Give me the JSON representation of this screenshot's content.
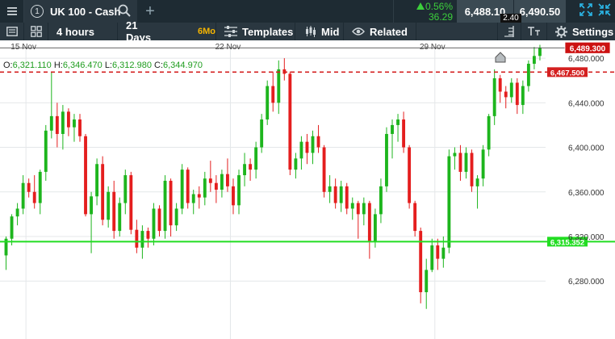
{
  "header": {
    "tab_number": "1",
    "instrument": "UK 100 - Cash",
    "change_pct": "0.56%",
    "change_pts": "36.29",
    "sell_price": "6,488.10",
    "buy_price": "6,490.50",
    "spread": "2.40",
    "icons": [
      "menu-icon",
      "search-icon",
      "plus-icon",
      "triangle-up-icon",
      "expand-icon",
      "collapse-icon"
    ]
  },
  "toolbar": {
    "interval": "4 hours",
    "range": "21 Days",
    "range_badge": "6Mo",
    "templates": "Templates",
    "price_type": "Mid",
    "related": "Related",
    "settings": "Settings",
    "icons": [
      "panel-icon",
      "grid-icon",
      "sliders-icon",
      "candles-icon",
      "eye-icon",
      "ruler-icon",
      "text-icon",
      "gear-icon"
    ]
  },
  "colors": {
    "up": "#1db51d",
    "down": "#e41e1e",
    "current_price": "#cc1111",
    "level": "#22dd22",
    "topbar": "#1e2b33",
    "toolbar": "#2a3740"
  },
  "ohlc": {
    "o_label": "O:",
    "o": "6,321.110",
    "h_label": "H:",
    "h": "6,346.470",
    "l_label": "L:",
    "l": "6,312.980",
    "c_label": "C:",
    "c": "6,344.970"
  },
  "chart_data": {
    "type": "candlestick",
    "x_labels": [
      {
        "label": "15 Nov",
        "index": 4
      },
      {
        "label": "22 Nov",
        "index": 40
      },
      {
        "label": "29 Nov",
        "index": 76
      }
    ],
    "y_ticks": [
      6280,
      6320,
      6360,
      6400,
      6440,
      6480
    ],
    "y_tick_labels": [
      "6,280.000",
      "6,320.000",
      "6,360.000",
      "6,400.000",
      "6,440.000",
      "6,480.000"
    ],
    "ylim": [
      6228,
      6496
    ],
    "current_price": {
      "value": 6489.3,
      "label": "6,489.300"
    },
    "dashed_level": {
      "value": 6467.5,
      "label": "6,467.500"
    },
    "support_level": {
      "value": 6315.352,
      "label": "6,315.352"
    },
    "candles": [
      [
        6303,
        6320,
        6290,
        6318
      ],
      [
        6318,
        6340,
        6312,
        6338
      ],
      [
        6338,
        6350,
        6330,
        6345
      ],
      [
        6345,
        6375,
        6340,
        6368
      ],
      [
        6368,
        6372,
        6355,
        6360
      ],
      [
        6360,
        6375,
        6345,
        6350
      ],
      [
        6350,
        6380,
        6340,
        6378
      ],
      [
        6378,
        6420,
        6370,
        6415
      ],
      [
        6415,
        6468,
        6408,
        6428
      ],
      [
        6428,
        6440,
        6400,
        6412
      ],
      [
        6412,
        6438,
        6398,
        6432
      ],
      [
        6432,
        6435,
        6410,
        6418
      ],
      [
        6418,
        6430,
        6405,
        6425
      ],
      [
        6425,
        6430,
        6405,
        6410
      ],
      [
        6410,
        6412,
        6338,
        6340
      ],
      [
        6340,
        6360,
        6305,
        6356
      ],
      [
        6356,
        6390,
        6348,
        6385
      ],
      [
        6385,
        6392,
        6330,
        6335
      ],
      [
        6335,
        6365,
        6328,
        6360
      ],
      [
        6360,
        6370,
        6318,
        6325
      ],
      [
        6325,
        6355,
        6320,
        6350
      ],
      [
        6350,
        6380,
        6340,
        6375
      ],
      [
        6375,
        6378,
        6322,
        6326
      ],
      [
        6326,
        6335,
        6305,
        6310
      ],
      [
        6310,
        6330,
        6300,
        6325
      ],
      [
        6325,
        6328,
        6310,
        6318
      ],
      [
        6318,
        6350,
        6312,
        6345
      ],
      [
        6345,
        6348,
        6320,
        6325
      ],
      [
        6325,
        6375,
        6318,
        6370
      ],
      [
        6370,
        6372,
        6320,
        6330
      ],
      [
        6330,
        6350,
        6325,
        6345
      ],
      [
        6345,
        6385,
        6340,
        6380
      ],
      [
        6380,
        6382,
        6345,
        6350
      ],
      [
        6350,
        6362,
        6340,
        6358
      ],
      [
        6358,
        6365,
        6345,
        6355
      ],
      [
        6355,
        6378,
        6348,
        6372
      ],
      [
        6372,
        6388,
        6360,
        6368
      ],
      [
        6368,
        6375,
        6350,
        6362
      ],
      [
        6362,
        6380,
        6355,
        6376
      ],
      [
        6376,
        6390,
        6360,
        6365
      ],
      [
        6365,
        6372,
        6340,
        6348
      ],
      [
        6348,
        6380,
        6340,
        6375
      ],
      [
        6375,
        6395,
        6365,
        6385
      ],
      [
        6385,
        6390,
        6370,
        6380
      ],
      [
        6380,
        6405,
        6372,
        6400
      ],
      [
        6400,
        6430,
        6395,
        6425
      ],
      [
        6425,
        6460,
        6420,
        6455
      ],
      [
        6455,
        6468,
        6432,
        6440
      ],
      [
        6440,
        6478,
        6430,
        6470
      ],
      [
        6470,
        6480,
        6460,
        6466
      ],
      [
        6466,
        6468,
        6375,
        6380
      ],
      [
        6380,
        6395,
        6372,
        6390
      ],
      [
        6390,
        6410,
        6380,
        6405
      ],
      [
        6405,
        6412,
        6385,
        6395
      ],
      [
        6395,
        6415,
        6385,
        6410
      ],
      [
        6410,
        6420,
        6395,
        6400
      ],
      [
        6400,
        6402,
        6355,
        6360
      ],
      [
        6360,
        6375,
        6350,
        6365
      ],
      [
        6365,
        6372,
        6345,
        6350
      ],
      [
        6350,
        6370,
        6342,
        6365
      ],
      [
        6365,
        6368,
        6340,
        6345
      ],
      [
        6345,
        6355,
        6335,
        6350
      ],
      [
        6350,
        6352,
        6318,
        6340
      ],
      [
        6340,
        6355,
        6330,
        6350
      ],
      [
        6350,
        6352,
        6300,
        6315
      ],
      [
        6315,
        6345,
        6310,
        6340
      ],
      [
        6340,
        6372,
        6332,
        6365
      ],
      [
        6365,
        6418,
        6360,
        6412
      ],
      [
        6412,
        6425,
        6390,
        6420
      ],
      [
        6420,
        6430,
        6405,
        6425
      ],
      [
        6425,
        6432,
        6395,
        6400
      ],
      [
        6400,
        6402,
        6345,
        6350
      ],
      [
        6350,
        6352,
        6320,
        6325
      ],
      [
        6325,
        6328,
        6260,
        6270
      ],
      [
        6270,
        6300,
        6255,
        6290
      ],
      [
        6290,
        6318,
        6288,
        6312
      ],
      [
        6312,
        6318,
        6290,
        6300
      ],
      [
        6300,
        6320,
        6292,
        6310
      ],
      [
        6310,
        6398,
        6305,
        6392
      ],
      [
        6392,
        6400,
        6380,
        6395
      ],
      [
        6395,
        6402,
        6370,
        6378
      ],
      [
        6378,
        6400,
        6372,
        6395
      ],
      [
        6395,
        6398,
        6360,
        6365
      ],
      [
        6365,
        6375,
        6345,
        6372
      ],
      [
        6372,
        6402,
        6365,
        6398
      ],
      [
        6398,
        6430,
        6392,
        6428
      ],
      [
        6428,
        6470,
        6420,
        6462
      ],
      [
        6462,
        6465,
        6440,
        6450
      ],
      [
        6450,
        6455,
        6435,
        6445
      ],
      [
        6445,
        6462,
        6440,
        6458
      ],
      [
        6458,
        6462,
        6430,
        6438
      ],
      [
        6438,
        6460,
        6430,
        6455
      ],
      [
        6455,
        6478,
        6450,
        6475
      ],
      [
        6475,
        6490,
        6470,
        6482
      ],
      [
        6482,
        6492,
        6478,
        6489
      ]
    ]
  }
}
